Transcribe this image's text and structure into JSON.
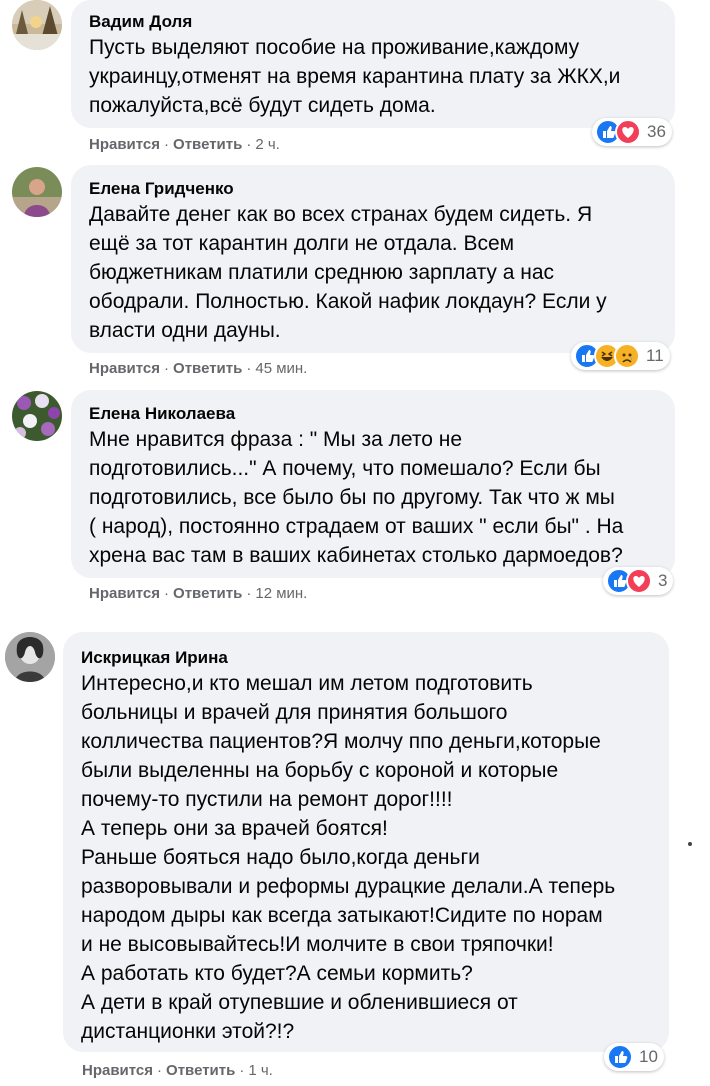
{
  "colors": {
    "bubble": "#f0f2f5",
    "like": "#1877f2",
    "love": "#f33e58",
    "haha": "#f7b125",
    "meta_text": "#65676b"
  },
  "comments": [
    {
      "author": "Вадим Доля",
      "text": "Пусть выделяют пособие на проживание,каждому\nукраинцу,отменят на время карантина плату за ЖКХ,и\nпожалуйста,всё будут сидеть дома.",
      "like": "Нравится",
      "reply": "Ответить",
      "time": "2 ч.",
      "reaction_icons": [
        "like-icon",
        "love-icon"
      ],
      "reaction_count": "36"
    },
    {
      "author": "Елена Гридченко",
      "text": "Давайте денег как во всех странах будем сидеть. Я\nещё за тот карантин долги не отдала. Всем\nбюджетникам платили среднюю зарплату а нас\nободрали. Полностью. Какой нафик локдаун? Если у\nвласти одни дауны.",
      "like": "Нравится",
      "reply": "Ответить",
      "time": "45 мин.",
      "reaction_icons": [
        "like-icon",
        "haha-icon",
        "sad-icon"
      ],
      "reaction_count": "11"
    },
    {
      "author": "Елена Николаева",
      "text": "Мне нравится фраза : \" Мы за лето не\nподготовились...\" А почему, что помешало? Если бы\nподготовились, все было бы по другому. Так что ж мы\n( народ), постоянно страдаем от ваших \" если бы\" . На\nхрена вас там в ваших кабинетах столько дармоедов?",
      "like": "Нравится",
      "reply": "Ответить",
      "time": "12 мин.",
      "reaction_icons": [
        "like-icon",
        "love-icon"
      ],
      "reaction_count": "3"
    },
    {
      "author": "Искрицкая Ирина",
      "text": "Интересно,и кто мешал им летом подготовить\nбольницы и врачей для принятия большого\nколличества пациентов?Я молчу ппо деньги,которые\nбыли выделенны на борьбу с короной и которые\nпочему-то пустили на ремонт дорог!!!!\nА теперь они за врачей боятся!\nРаньше бояться надо было,когда деньги\nразворовывали и реформы дурацкие делали.А теперь\nнародом дыры как всегда затыкают!Сидите по норам\nи не высовывайтесь!И молчите в свои тряпочки!\nА работать кто будет?А семьи кормить?\nА дети в край отупевшие и обленившиеся от\nдистанционки этой?!?",
      "like": "Нравится",
      "reply": "Ответить",
      "time": "1 ч.",
      "reaction_icons": [
        "like-icon"
      ],
      "reaction_count": "10"
    }
  ]
}
